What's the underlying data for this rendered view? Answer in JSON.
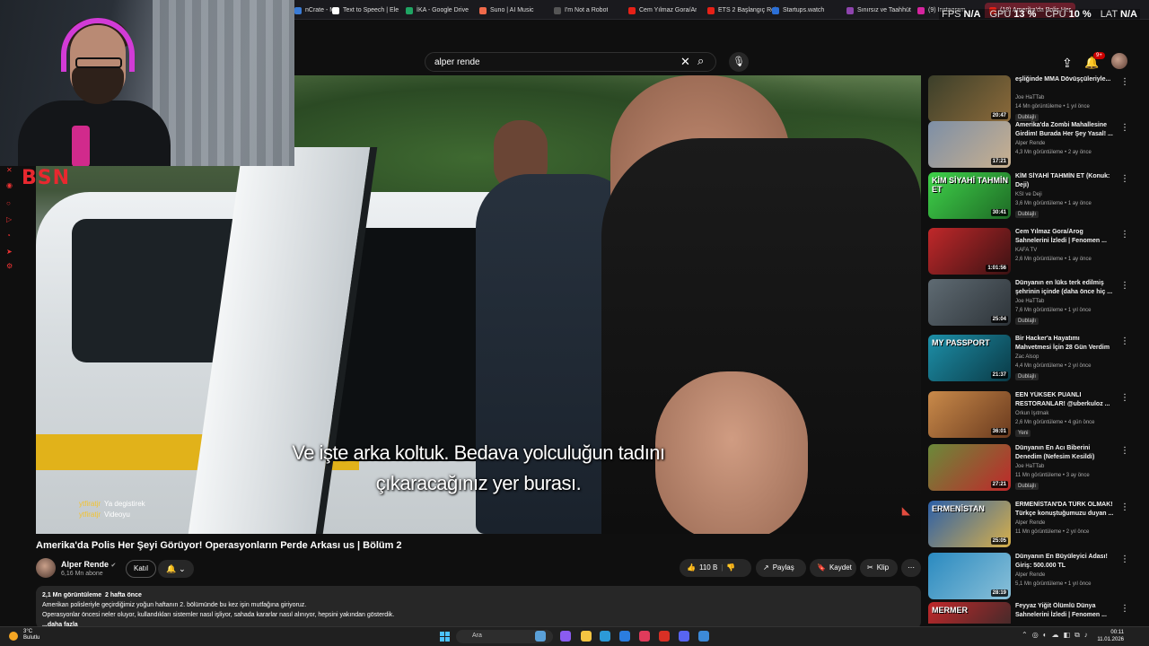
{
  "browser": {
    "tabs": [
      {
        "label": "nCrate - M",
        "color": "#3a7bd5"
      },
      {
        "label": "Text to Speech | Ele",
        "color": "#ffffff"
      },
      {
        "label": "İKA - Google Drive",
        "color": "#1fa463"
      },
      {
        "label": "Suno | AI Music",
        "color": "#f06a4a"
      },
      {
        "label": "I'm Not a Robot",
        "color": "#555555"
      },
      {
        "label": "Cem Yılmaz Gora/Ar",
        "color": "#e62117"
      },
      {
        "label": "ETS 2 Başlangıç Reh",
        "color": "#e62117"
      },
      {
        "label": "Startups.watch",
        "color": "#2b6fd6"
      },
      {
        "label": "Sınırsız ve Taahhüt",
        "color": "#8e44ad"
      },
      {
        "label": "(9) Instagram",
        "color": "#d6249f"
      },
      {
        "label": "(18) Amerika'da Polis Her",
        "color": "#e62117"
      }
    ],
    "perf": {
      "fps_label": "FPS",
      "fps_value": "N/A",
      "gpu_label": "GPU",
      "gpu_value": "13 %",
      "cpu_label": "CPU",
      "cpu_value": "10 %",
      "lat_label": "LAT",
      "lat_value": "N/A"
    },
    "aux_label": "AI"
  },
  "youtube": {
    "search_value": "alper rende",
    "notification_count": "9+"
  },
  "overlay_logo": "BSN",
  "video": {
    "subtitle_line1": "Ve işte arka koltuk. Bedava yolculuğun tadını",
    "subtitle_line2": "çıkaracağınız yer burası.",
    "chat": [
      {
        "user": "ytfiratjr",
        "message": "Ya degistirek"
      },
      {
        "user": "ytfiratjr",
        "message": "Videoyu"
      }
    ],
    "title": "Amerika'da Polis Her Şeyi Görüyor! Operasyonların Perde Arkası us | Bölüm 2",
    "channel": "Alper Rende",
    "subscribers": "6,16 Mn abone",
    "join_label": "Katıl",
    "like_count": "110 B",
    "share_label": "Paylaş",
    "save_label": "Kaydet",
    "clip_label": "Klip",
    "views": "2,1 Mn görüntüleme",
    "age": "2 hafta önce",
    "description": [
      "Amerikan polisleriyle geçirdiğimiz yoğun haftanın 2. bölümünde bu kez işin mutfağına giriyoruz.",
      "Operasyonlar öncesi neler oluyor, kullandıkları sistemler nasıl işliyor, sahada kararlar nasıl alınıyor, hepsini yakından gösterdik.",
      "...daha fazla"
    ]
  },
  "recommendations": [
    {
      "title": "eşliğinde MMA Dövüşçüleriyle...",
      "channel": "Joe HaTTab",
      "views": "14 Mn görüntüleme",
      "age": "1 yıl önce",
      "duration": "20:47",
      "badge": "Dublajlı",
      "thumb": [
        "#3b3f2a",
        "#8c6a3a"
      ],
      "thumb_text": ""
    },
    {
      "title": "Amerika'da Zombi Mahallesine Girdim! Burada Her Şey Yasal! ...",
      "channel": "Alper Rende",
      "views": "4,3 Mn görüntüleme",
      "age": "2 ay önce",
      "duration": "17:21",
      "badge": "",
      "thumb": [
        "#7d8fa6",
        "#c9b08f"
      ],
      "thumb_text": ""
    },
    {
      "title": "KİM SİYAHİ TAHMİN ET (Konuk: Deji)",
      "channel": "KSI ve Deji",
      "views": "3,6 Mn görüntüleme",
      "age": "1 ay önce",
      "duration": "30:41",
      "badge": "Dublajlı",
      "thumb": [
        "#3fd24a",
        "#1e6a25"
      ],
      "thumb_text": "KİM SİYAHİ TAHMİN ET"
    },
    {
      "title": "Cem Yılmaz Gora/Arog Sahnelerini İzledi | Fenomen ...",
      "channel": "KAFA TV",
      "views": "2,6 Mn görüntüleme",
      "age": "1 ay önce",
      "duration": "1:01:56",
      "badge": "",
      "thumb": [
        "#c0282a",
        "#3b1213"
      ],
      "thumb_text": ""
    },
    {
      "title": "Dünyanın en lüks terk edilmiş şehrinin içinde (daha önce hiç ...",
      "channel": "Joe HaTTab",
      "views": "7,6 Mn görüntüleme",
      "age": "1 yıl önce",
      "duration": "25:04",
      "badge": "Dublajlı",
      "thumb": [
        "#5f6b73",
        "#2d3338"
      ],
      "thumb_text": ""
    },
    {
      "title": "Bir Hacker'a Hayatımı Mahvetmesi İçin 28 Gün Verdim",
      "channel": "Zac Alsop",
      "views": "4,4 Mn görüntüleme",
      "age": "2 yıl önce",
      "duration": "21:37",
      "badge": "Dublajlı",
      "thumb": [
        "#1d8fa8",
        "#0a3a46"
      ],
      "thumb_text": "MY PASSPORT"
    },
    {
      "title": "EEN YÜKSEK PUANLI RESTORANLAR! @uberkuloz ...",
      "channel": "Orkun Işıtmak",
      "views": "2,6 Mn görüntüleme",
      "age": "4 gün önce",
      "duration": "36:01",
      "badge": "Yeni",
      "thumb": [
        "#c98a4a",
        "#6a3a1e"
      ],
      "thumb_text": ""
    },
    {
      "title": "Dünyanın En Acı Biberini Denedim (Nefesim Kesildi)",
      "channel": "Joe HaTTab",
      "views": "11 Mn görüntüleme",
      "age": "3 ay önce",
      "duration": "27:21",
      "badge": "Dublajlı",
      "thumb": [
        "#6a8a3a",
        "#c0282a"
      ],
      "thumb_text": ""
    },
    {
      "title": "ERMENİSTAN'DA TÜRK OLMAK! Türkçe konuştuğumuzu duyan ...",
      "channel": "Alper Rende",
      "views": "11 Mn görüntüleme",
      "age": "2 yıl önce",
      "duration": "25:05",
      "badge": "",
      "thumb": [
        "#2b5fa8",
        "#d8b04a"
      ],
      "thumb_text": "ERMENİSTAN"
    },
    {
      "title": "Dünyanın En Büyüleyici Adası! Giriş: 500.000 TL",
      "channel": "Alper Rende",
      "views": "5,1 Mn görüntüleme",
      "age": "1 yıl önce",
      "duration": "28:19",
      "badge": "",
      "thumb": [
        "#2a8ac0",
        "#8ac0d8"
      ],
      "thumb_text": ""
    },
    {
      "title": "Feyyaz Yiğit Ölümlü Dünya Sahnelerini İzledi | Fenomen ...",
      "channel": "",
      "views": "",
      "age": "",
      "duration": "",
      "badge": "",
      "thumb": [
        "#c0282a",
        "#2a2a2a"
      ],
      "thumb_text": "MERMER"
    }
  ],
  "taskbar": {
    "temp": "3°C",
    "weather": "Bulutlu",
    "search_placeholder": "Ara",
    "time": "00:11",
    "date": "11.01.2026"
  }
}
